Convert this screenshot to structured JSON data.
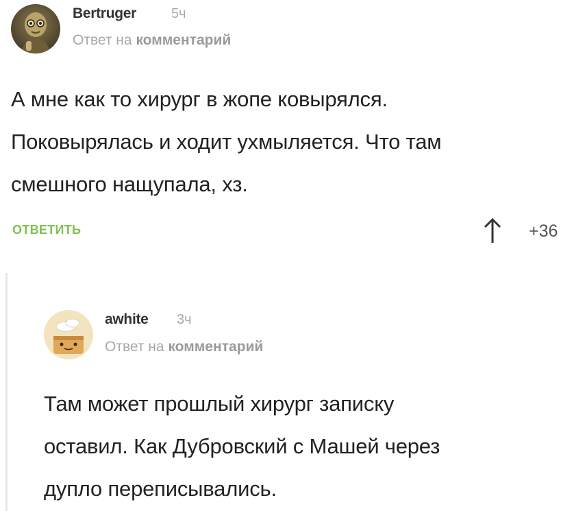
{
  "comments": [
    {
      "author": "Bertruger",
      "time": "5ч",
      "reply_prefix": "Ответ на",
      "reply_link": "комментарий",
      "text_lines": [
        "А мне как то хирург в жопе ковырялся.",
        "Поковырялась и ходит ухмыляется. Что там",
        "смешного нащупала, хз."
      ],
      "reply_button": "ОТВЕТИТЬ",
      "rating": "+36",
      "avatar_icon": "alien-figure-avatar"
    },
    {
      "author": "awhite",
      "time": "3ч",
      "reply_prefix": "Ответ на",
      "reply_link": "комментарий",
      "text_lines": [
        "Там может прошлый хирург записку",
        "оставил. Как Дубровский с Машей через",
        "дупло переписывались."
      ],
      "avatar_icon": "toast-character-avatar"
    }
  ],
  "colors": {
    "accent_green": "#7fc14f",
    "muted_gray": "#a8a8a8",
    "text": "#222222",
    "thread_line": "#e6e6e6"
  }
}
